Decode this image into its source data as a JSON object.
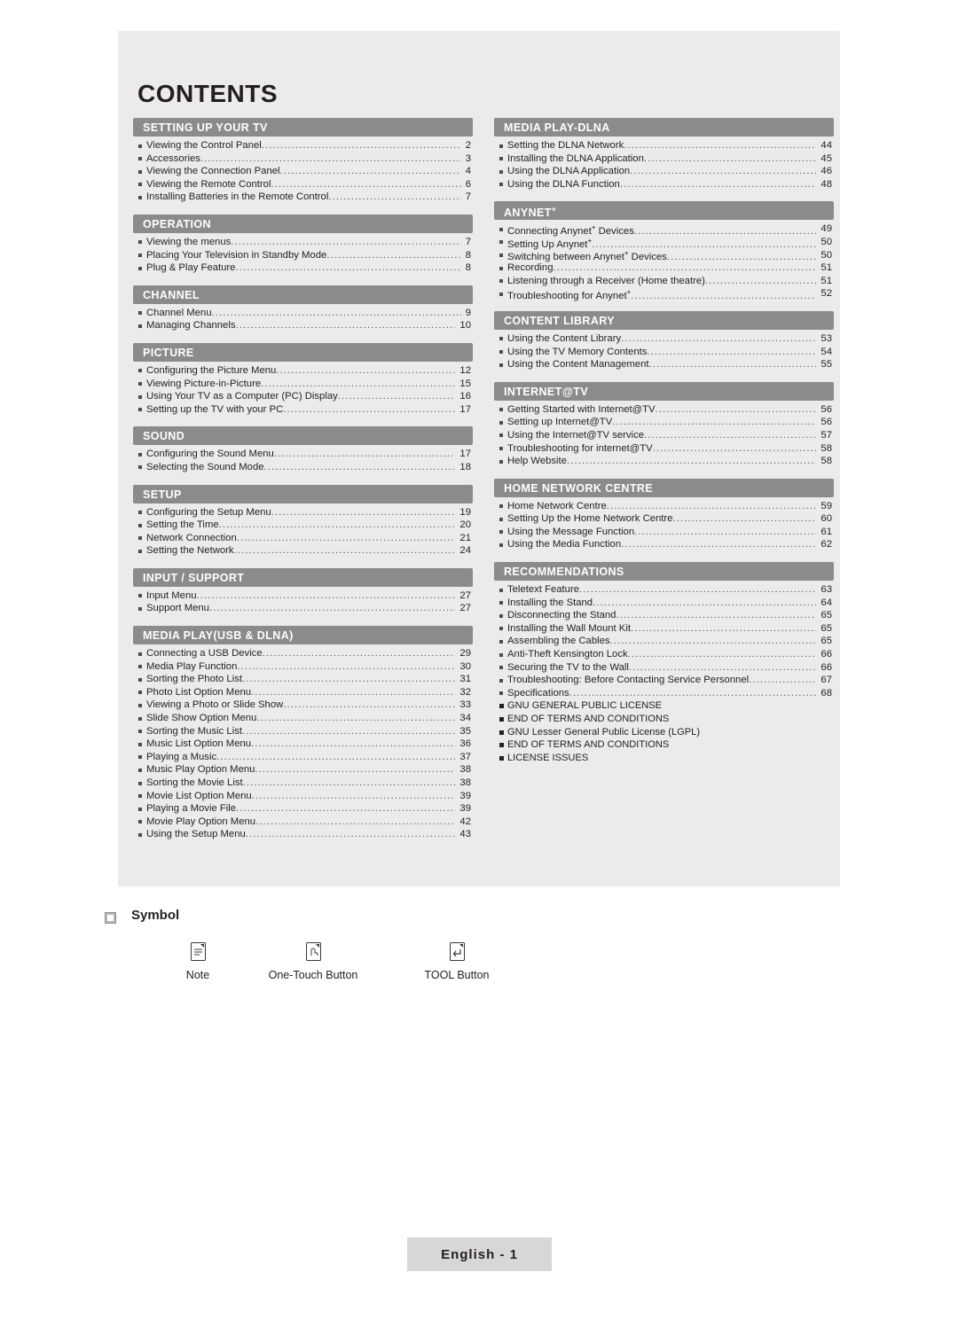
{
  "page": {
    "title": "CONTENTS",
    "footer_label": "English - 1"
  },
  "symbol": {
    "heading": "Symbol",
    "items": [
      {
        "glyph": "note-icon",
        "label": "Note"
      },
      {
        "glyph": "one-touch-button-icon",
        "label": "One-Touch Button"
      },
      {
        "glyph": "tool-button-icon",
        "label": "TOOL Button"
      }
    ]
  },
  "left_column": [
    {
      "heading": "SETTING UP YOUR TV",
      "entries": [
        {
          "text": "Viewing the Control Panel",
          "page": "2"
        },
        {
          "text": "Accessories",
          "page": "3"
        },
        {
          "text": "Viewing the Connection Panel",
          "page": "4"
        },
        {
          "text": "Viewing the Remote Control",
          "page": "6"
        },
        {
          "text": "Installing Batteries in the Remote Control",
          "page": "7"
        }
      ]
    },
    {
      "heading": "OPERATION",
      "entries": [
        {
          "text": "Viewing the menus",
          "page": "7"
        },
        {
          "text": "Placing Your Television in Standby Mode",
          "page": "8"
        },
        {
          "text": "Plug & Play Feature",
          "page": "8"
        }
      ]
    },
    {
      "heading": "CHANNEL",
      "entries": [
        {
          "text": "Channel Menu",
          "page": "9"
        },
        {
          "text": "Managing Channels",
          "page": "10"
        }
      ]
    },
    {
      "heading": "PICTURE",
      "entries": [
        {
          "text": "Configuring the Picture Menu",
          "page": "12"
        },
        {
          "text": "Viewing Picture-in-Picture",
          "page": "15"
        },
        {
          "text": "Using Your TV as a Computer (PC) Display",
          "page": "16"
        },
        {
          "text": "Setting up the TV with your PC",
          "page": "17"
        }
      ]
    },
    {
      "heading": "SOUND",
      "entries": [
        {
          "text": "Configuring the Sound Menu",
          "page": "17"
        },
        {
          "text": "Selecting the Sound Mode",
          "page": "18"
        }
      ]
    },
    {
      "heading": "SETUP",
      "entries": [
        {
          "text": "Configuring the Setup Menu",
          "page": "19"
        },
        {
          "text": "Setting the Time",
          "page": "20"
        },
        {
          "text": "Network Connection",
          "page": "21"
        },
        {
          "text": "Setting the Network",
          "page": "24"
        }
      ]
    },
    {
      "heading": "INPUT / SUPPORT",
      "entries": [
        {
          "text": "Input Menu",
          "page": "27"
        },
        {
          "text": "Support Menu",
          "page": "27"
        }
      ]
    },
    {
      "heading": "MEDIA PLAY(USB & DLNA)",
      "entries": [
        {
          "text": "Connecting a USB Device",
          "page": "29"
        },
        {
          "text": "Media Play Function",
          "page": "30"
        },
        {
          "text": "Sorting the Photo List",
          "page": "31"
        },
        {
          "text": "Photo List Option Menu",
          "page": "32"
        },
        {
          "text": "Viewing a Photo or Slide Show",
          "page": "33"
        },
        {
          "text": "Slide Show Option Menu",
          "page": "34"
        },
        {
          "text": "Sorting the Music List",
          "page": "35"
        },
        {
          "text": "Music List Option Menu",
          "page": "36"
        },
        {
          "text": "Playing a Music",
          "page": "37"
        },
        {
          "text": "Music Play Option Menu",
          "page": "38"
        },
        {
          "text": "Sorting the Movie List",
          "page": "38"
        },
        {
          "text": "Movie List Option Menu",
          "page": "39"
        },
        {
          "text": "Playing a Movie File",
          "page": "39"
        },
        {
          "text": "Movie Play Option Menu",
          "page": "42"
        },
        {
          "text": "Using the Setup Menu",
          "page": "43"
        }
      ]
    }
  ],
  "right_column": [
    {
      "heading": "MEDIA PLAY-DLNA",
      "entries": [
        {
          "text": "Setting the DLNA Network",
          "page": "44"
        },
        {
          "text": "Installing the DLNA Application",
          "page": "45"
        },
        {
          "text": "Using the DLNA Application",
          "page": "46"
        },
        {
          "text": "Using the DLNA Function",
          "page": "48"
        }
      ]
    },
    {
      "heading": "ANYNET+",
      "entries": [
        {
          "text": "Connecting Anynet+ Devices",
          "page": "49"
        },
        {
          "text": "Setting Up Anynet+",
          "page": "50"
        },
        {
          "text": "Switching between Anynet+ Devices",
          "page": "50"
        },
        {
          "text": "Recording",
          "page": "51"
        },
        {
          "text": "Listening through a Receiver (Home theatre)",
          "page": "51"
        },
        {
          "text": "Troubleshooting for Anynet+",
          "page": "52"
        }
      ]
    },
    {
      "heading": "CONTENT LIBRARY",
      "entries": [
        {
          "text": "Using the Content Library",
          "page": "53"
        },
        {
          "text": "Using the TV Memory Contents",
          "page": "54"
        },
        {
          "text": "Using the Content Management",
          "page": "55"
        }
      ]
    },
    {
      "heading": "INTERNET@TV",
      "entries": [
        {
          "text": "Getting Started with Internet@TV",
          "page": "56"
        },
        {
          "text": "Setting up Internet@TV",
          "page": "56"
        },
        {
          "text": "Using the Internet@TV service",
          "page": "57"
        },
        {
          "text": "Troubleshooting for internet@TV",
          "page": "58"
        },
        {
          "text": "Help Website",
          "page": "58"
        }
      ]
    },
    {
      "heading": "HOME NETWORK CENTRE",
      "entries": [
        {
          "text": "Home Network Centre",
          "page": "59"
        },
        {
          "text": "Setting Up the Home Network Centre",
          "page": "60"
        },
        {
          "text": "Using the Message Function",
          "page": "61"
        },
        {
          "text": "Using the Media Function",
          "page": "62"
        }
      ]
    },
    {
      "heading": "RECOMMENDATIONS",
      "entries": [
        {
          "text": "Teletext Feature",
          "page": "63"
        },
        {
          "text": "Installing the Stand",
          "page": "64"
        },
        {
          "text": "Disconnecting the Stand",
          "page": "65"
        },
        {
          "text": "Installing the Wall Mount Kit",
          "page": "65"
        },
        {
          "text": "Assembling the Cables",
          "page": "65"
        },
        {
          "text": "Anti-Theft Kensington Lock",
          "page": "66"
        },
        {
          "text": "Securing the TV to the Wall",
          "page": "66"
        },
        {
          "text": "Troubleshooting: Before Contacting Service Personnel",
          "page": "67"
        },
        {
          "text": "Specifications",
          "page": "68"
        },
        {
          "text": "GNU GENERAL PUBLIC LICENSE",
          "page": ""
        },
        {
          "text": "END OF TERMS AND CONDITIONS",
          "page": ""
        },
        {
          "text": "GNU Lesser General Public License (LGPL)",
          "page": ""
        },
        {
          "text": "END OF TERMS AND CONDITIONS",
          "page": ""
        },
        {
          "text": "LICENSE ISSUES",
          "page": ""
        }
      ]
    }
  ]
}
